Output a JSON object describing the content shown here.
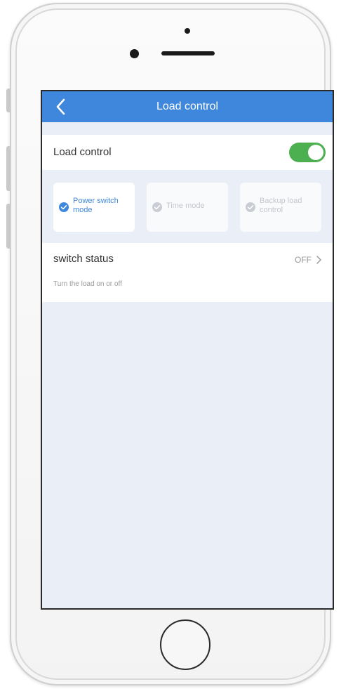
{
  "navbar": {
    "title": "Load control",
    "back_icon": "chevron-left-icon",
    "color": "#3f87dd"
  },
  "load_control": {
    "label": "Load control",
    "enabled": true,
    "toggle_color": "#4caf50"
  },
  "modes": [
    {
      "label": "Power switch mode",
      "selected": true
    },
    {
      "label": "Time mode",
      "selected": false
    },
    {
      "label": "Backup load control",
      "selected": false
    }
  ],
  "colors": {
    "selected_mode": "#3f87dd",
    "unselected_mode": "#c9ccd2"
  },
  "switch_status": {
    "label": "switch status",
    "description": "Turn the load on or off",
    "value": "OFF",
    "chevron_icon": "chevron-right-icon"
  }
}
